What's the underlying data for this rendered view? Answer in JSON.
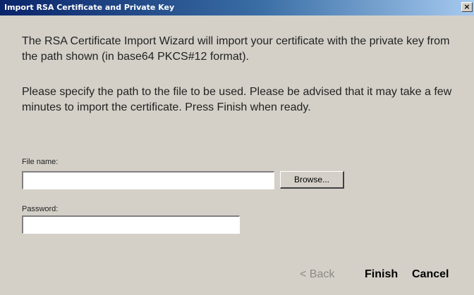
{
  "window": {
    "title": "Import RSA Certificate and Private Key",
    "close_glyph": "×"
  },
  "intro": {
    "paragraph1": "The RSA Certificate Import Wizard will import your certificate with the private key from the path shown (in base64 PKCS#12 format).",
    "paragraph2": "Please specify the path to the file to be used.  Please be advised that it may take a few minutes to import the certificate.  Press Finish when ready."
  },
  "form": {
    "file_name_label": "File name:",
    "file_name_value": "",
    "browse_label": "Browse...",
    "password_label": "Password:",
    "password_value": ""
  },
  "buttons": {
    "back": "< Back",
    "finish": "Finish",
    "cancel": "Cancel"
  },
  "colors": {
    "titlebar_start": "#0a246a",
    "titlebar_end": "#a6caf0",
    "dialog_background": "#d4d0c8",
    "disabled_text": "#8c8a85"
  }
}
